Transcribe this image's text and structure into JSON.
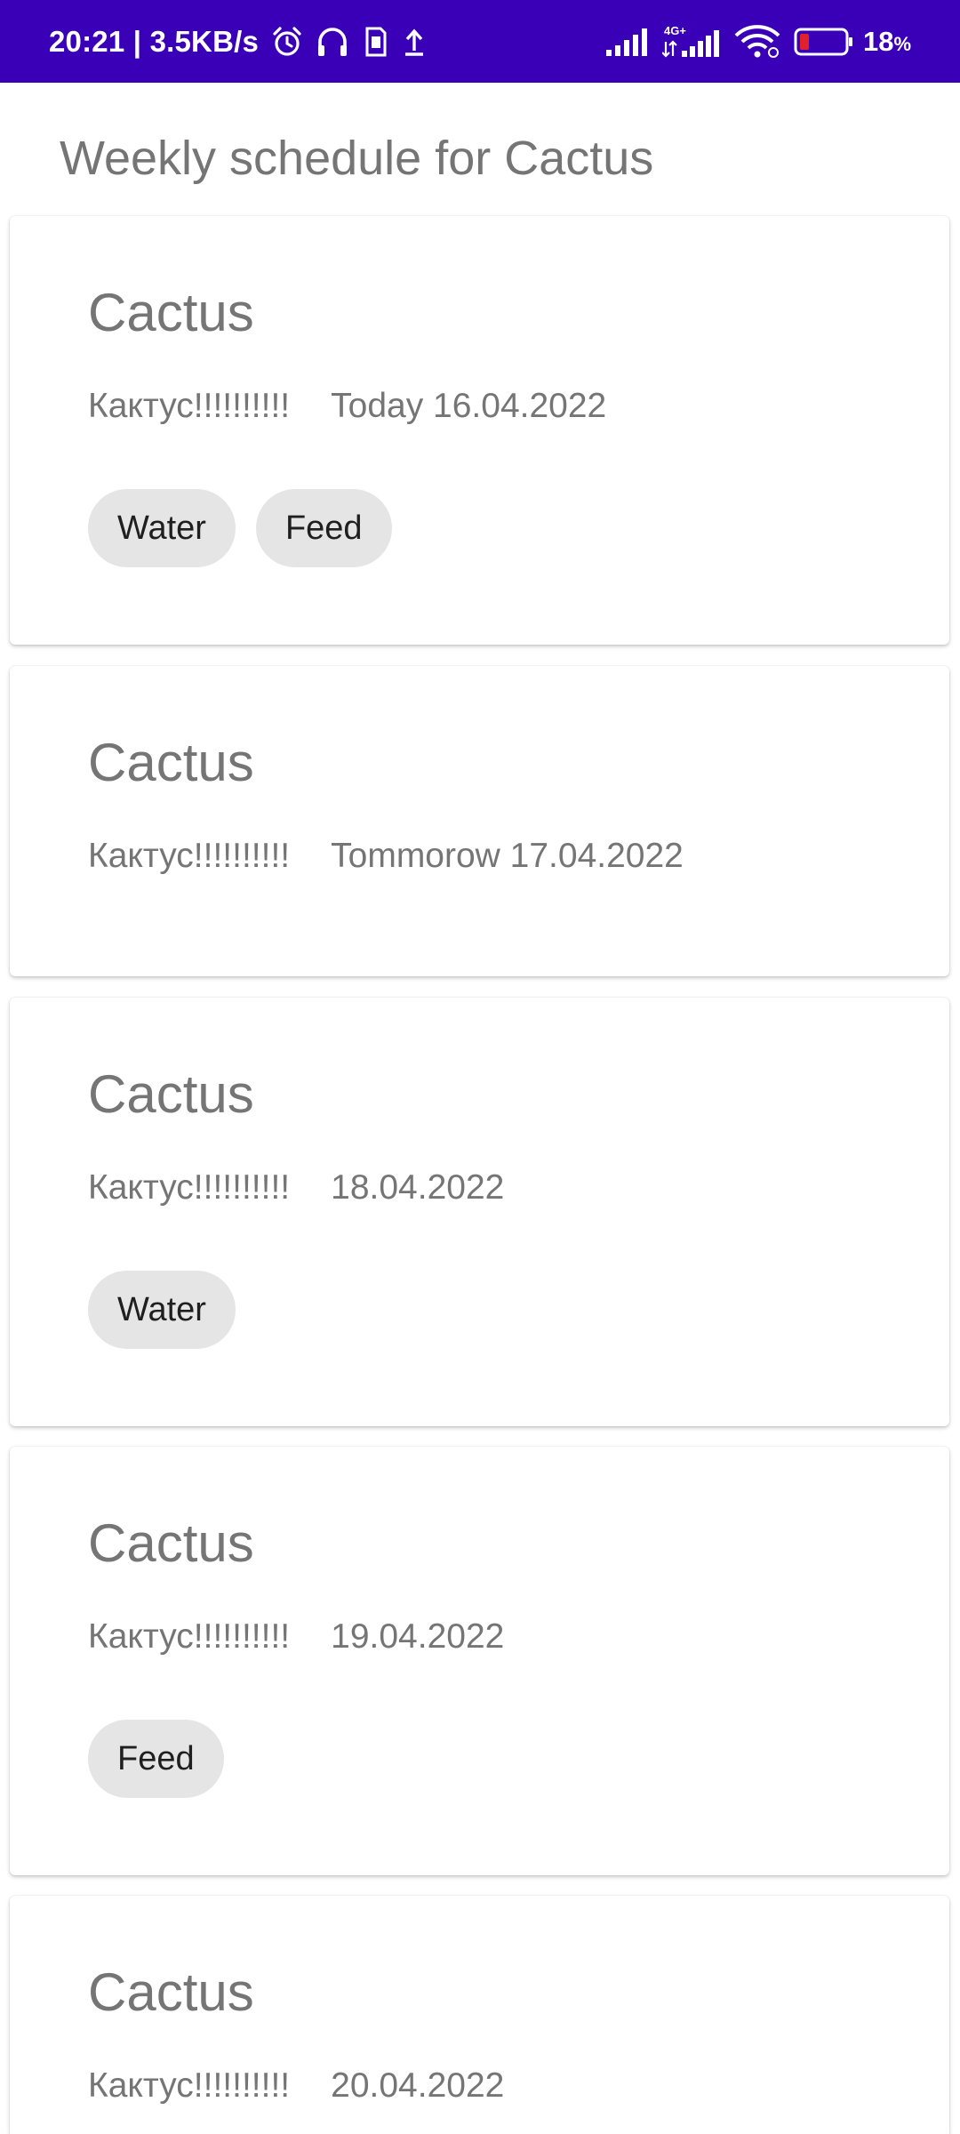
{
  "status_bar": {
    "time_speed": "20:21 | 3.5KB/s",
    "network_label": "4G+",
    "battery_value": "18",
    "battery_unit": "%",
    "icons": [
      "alarm-icon",
      "headphones-icon",
      "sim-card-icon",
      "upload-icon",
      "signal-icon",
      "signal-4g-icon",
      "wifi-icon",
      "battery-icon"
    ],
    "background_color": "#3a00b8"
  },
  "page": {
    "title": "Weekly schedule for Cactus"
  },
  "cards": [
    {
      "title": "Cactus",
      "subtitle": "Кактус!!!!!!!!!!",
      "date": "Today 16.04.2022",
      "chips": [
        "Water",
        "Feed"
      ]
    },
    {
      "title": "Cactus",
      "subtitle": "Кактус!!!!!!!!!!",
      "date": "Tommorow 17.04.2022",
      "chips": []
    },
    {
      "title": "Cactus",
      "subtitle": "Кактус!!!!!!!!!!",
      "date": "18.04.2022",
      "chips": [
        "Water"
      ]
    },
    {
      "title": "Cactus",
      "subtitle": "Кактус!!!!!!!!!!",
      "date": "19.04.2022",
      "chips": [
        "Feed"
      ]
    },
    {
      "title": "Cactus",
      "subtitle": "Кактус!!!!!!!!!!",
      "date": "20.04.2022",
      "chips": []
    }
  ]
}
